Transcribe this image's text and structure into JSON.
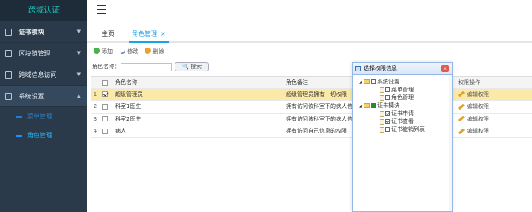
{
  "brand": "跨域认证",
  "sidebar": {
    "items": [
      {
        "label": "证书模块",
        "caret": "▼"
      },
      {
        "label": "区块链管理",
        "caret": "▼"
      },
      {
        "label": "跨域信息访问",
        "caret": "▼"
      },
      {
        "label": "系统设置",
        "caret": "▲"
      }
    ],
    "sub_items": [
      {
        "label": "菜单管理"
      },
      {
        "label": "角色管理"
      }
    ]
  },
  "tabs": {
    "home": "主页",
    "role": "角色管理",
    "close": "×"
  },
  "toolbar": {
    "add": "添加",
    "edit": "修改",
    "delete": "删除"
  },
  "search": {
    "label": "角色名称：",
    "button": "搜索"
  },
  "grid": {
    "headers": {
      "name": "角色名称",
      "note": "角色备注",
      "op": "权限操作"
    },
    "rows": [
      {
        "num": "1",
        "name": "超级管理员",
        "note": "超级管理员拥有一切权限",
        "op": "编辑权限",
        "selected": true
      },
      {
        "num": "2",
        "name": "科室1医生",
        "note": "拥有访问该科室下的病人信",
        "op": "编辑权限",
        "selected": false
      },
      {
        "num": "3",
        "name": "科室2医生",
        "note": "拥有访问该科室下的病人信",
        "op": "编辑权限",
        "selected": false
      },
      {
        "num": "4",
        "name": "病人",
        "note": "拥有访问自己信息的权限",
        "op": "编辑权限",
        "selected": false
      }
    ]
  },
  "dialog": {
    "title": "选择权限信息",
    "close": "×",
    "tree": [
      {
        "label": "系统设置",
        "level": 1,
        "type": "folder",
        "state": "off"
      },
      {
        "label": "菜单管理",
        "level": 3,
        "type": "file",
        "state": "off"
      },
      {
        "label": "角色管理",
        "level": 3,
        "type": "file",
        "state": "off"
      },
      {
        "label": "证书模块",
        "level": 1,
        "type": "folder",
        "state": "partial"
      },
      {
        "label": "证书申请",
        "level": 3,
        "type": "file",
        "state": "on"
      },
      {
        "label": "证书查看",
        "level": 3,
        "type": "file",
        "state": "on"
      },
      {
        "label": "证书撤销列表",
        "level": 3,
        "type": "file",
        "state": "off"
      }
    ]
  },
  "colors": {
    "sidebar_bg": "#2b3a4a",
    "accent": "#1aa3e8",
    "selected_row": "#fbe9a8"
  }
}
